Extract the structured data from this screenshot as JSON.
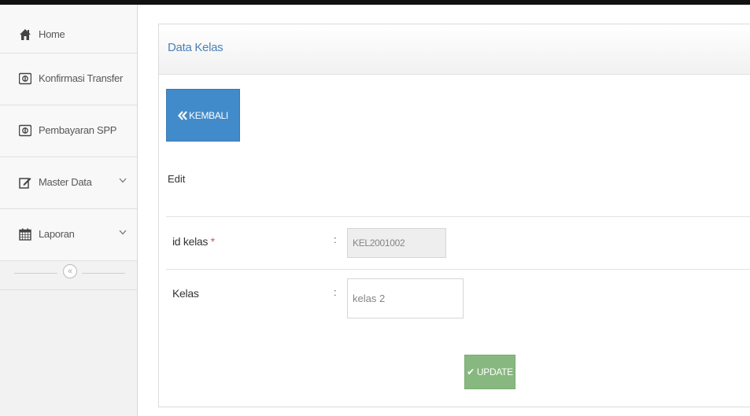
{
  "sidebar": {
    "items": [
      {
        "label": "Home",
        "icon": "home-icon"
      },
      {
        "label": "Konfirmasi Transfer",
        "icon": "money-icon"
      },
      {
        "label": "Pembayaran SPP",
        "icon": "money-icon"
      },
      {
        "label": "Master Data",
        "icon": "edit-icon",
        "has_submenu": true
      },
      {
        "label": "Laporan",
        "icon": "calendar-icon",
        "has_submenu": true
      }
    ],
    "collapse_glyph": "«"
  },
  "panel": {
    "title": "Data Kelas",
    "back_button": "KEMBALI",
    "section_label": "Edit"
  },
  "form": {
    "fields": [
      {
        "label": "id kelas",
        "required_mark": "*",
        "colon": ":",
        "value": "KEL2001002",
        "readonly": true
      },
      {
        "label": "Kelas",
        "colon": ":",
        "value": "kelas 2",
        "readonly": false
      }
    ],
    "submit_label": "UPDATE"
  },
  "colors": {
    "primary": "#428bca",
    "success": "#87b87f",
    "title": "#4a81b9",
    "required": "#d15b47"
  }
}
